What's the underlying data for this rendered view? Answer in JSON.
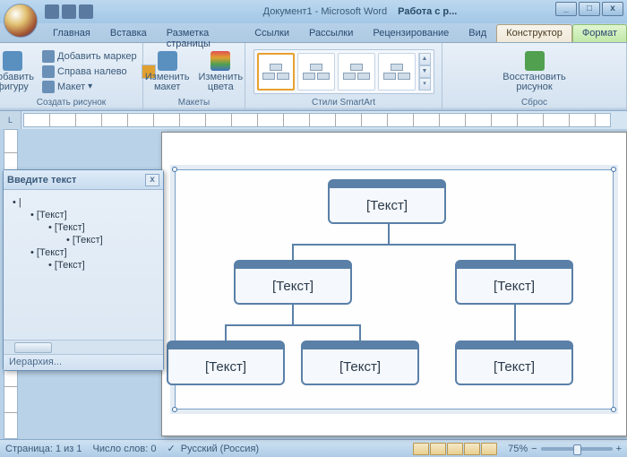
{
  "title": {
    "doc": "Документ1",
    "app": "Microsoft Word",
    "context": "Работа с р..."
  },
  "winbtns": {
    "min": "_",
    "max": "□",
    "close": "x"
  },
  "tabs": {
    "home": "Главная",
    "insert": "Вставка",
    "layout": "Разметка страницы",
    "refs": "Ссылки",
    "mail": "Рассылки",
    "review": "Рецензирование",
    "view": "Вид",
    "design": "Конструктор",
    "format": "Формат"
  },
  "ribbon": {
    "g1": {
      "label": "Создать рисунок",
      "add_shape": "Добавить\nфигуру",
      "bullet": "Добавить маркер",
      "rtl": "Справа налево",
      "layout": "Макет"
    },
    "g2": {
      "label": "Макеты",
      "change_layout": "Изменить\nмакет",
      "change_colors": "Изменить\nцвета"
    },
    "g3": {
      "label": "Стили SmartArt"
    },
    "g4": {
      "label": "Сброс",
      "reset": "Восстановить\nрисунок"
    }
  },
  "textpane": {
    "title": "Введите текст",
    "items": [
      "|",
      "[Текст]",
      "[Текст]",
      "[Текст]",
      "[Текст]",
      "[Текст]"
    ],
    "footer": "Иерархия..."
  },
  "smartart": {
    "placeholder": "[Текст]"
  },
  "status": {
    "page": "Страница: 1 из 1",
    "words": "Число слов: 0",
    "lang": "Русский (Россия)",
    "zoom": "75%"
  },
  "ruler_corner": "L"
}
